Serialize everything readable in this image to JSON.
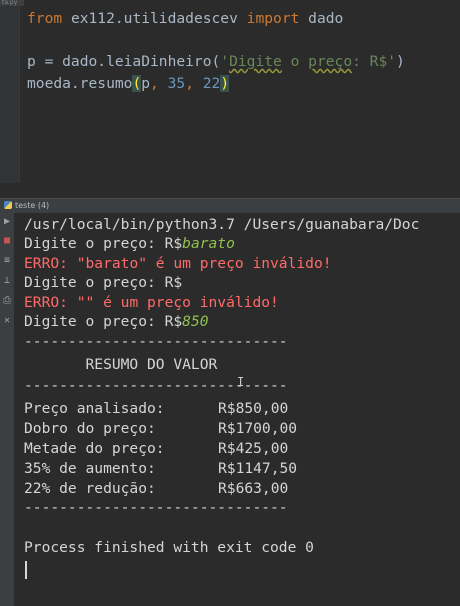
{
  "editor": {
    "tab_fragment": "ta.py",
    "lines": [
      {
        "kw1": "from",
        "mod": " ex112.utilidadescev ",
        "kw2": "import",
        "rest": " dado"
      },
      {
        "pre": "p = dado.leiaDinheiro(",
        "str_q1": "'",
        "str_typo1": "Digite",
        "str_mid": " o ",
        "str_typo2": "preço",
        "str_end": ": R$'",
        "post": ")"
      },
      {
        "pre": "moeda.resumo",
        "open": "(",
        "arg1": "p",
        "c1": ", ",
        "n1": "35",
        "c2": ", ",
        "n2": "22",
        "close": ")"
      }
    ]
  },
  "run": {
    "tab_label": "teste (4)",
    "toolbar_icons": [
      "rerun-icon",
      "stop-icon",
      "soft-wrap-icon",
      "pin-icon",
      "print-icon",
      "trash-icon"
    ]
  },
  "console": {
    "command": "/usr/local/bin/python3.7 /Users/guanabara/Doc",
    "prompt1": "Digite o preço: R$",
    "input1": "barato",
    "error1_label": "ERRO:",
    "error1_text": " \"barato\" é um preço inválido!",
    "prompt2": "Digite o preço: R$",
    "error2_label": "ERRO:",
    "error2_text": " \"\" é um preço inválido!",
    "prompt3": "Digite o preço: R$",
    "input3": "850",
    "rule1": "------------------------------",
    "summary_title": "       RESUMO DO VALOR",
    "rule2": "------------------------------",
    "rows": [
      {
        "label": "Preço analisado:",
        "value": "R$850,00"
      },
      {
        "label": "Dobro do preço:",
        "value": "R$1700,00"
      },
      {
        "label": "Metade do preço:",
        "value": "R$425,00"
      },
      {
        "label": "35% de aumento:",
        "value": "R$1147,50"
      },
      {
        "label": "22% de redução:",
        "value": "R$663,00"
      }
    ],
    "rule3": "------------------------------",
    "exit_message": "Process finished with exit code 0"
  }
}
